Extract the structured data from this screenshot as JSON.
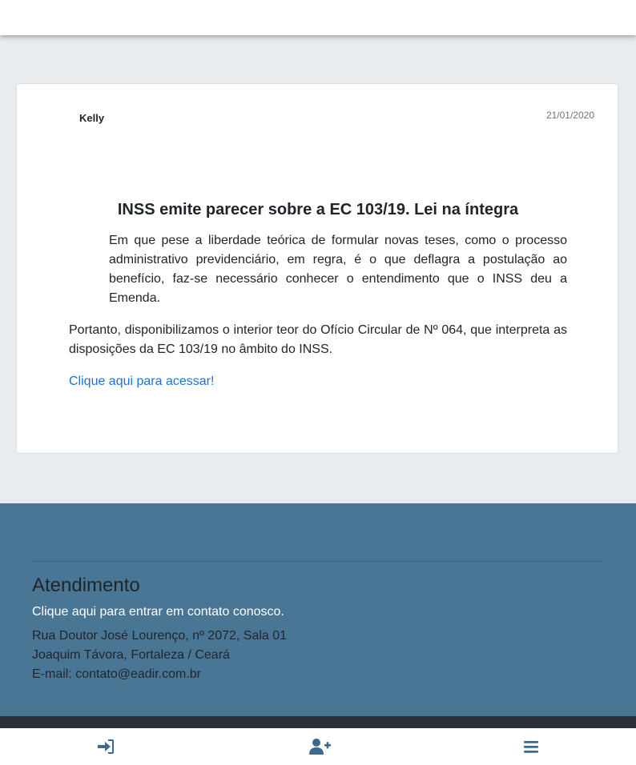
{
  "post": {
    "author": "Kelly",
    "date": "21/01/2020",
    "title": "INSS emite parecer sobre a EC 103/19. Lei na íntegra",
    "paragraphs": [
      "Em que pese a liberdade teórica de formular novas teses, como o processo administrativo previdenciário, em regra, é o que deflagra a postulação ao benefício, faz-se necessário conhecer o entendimento que o INSS deu a Emenda.",
      "Portanto, disponibilizamos o interior teor do Ofício Circular de Nº 064, que interpreta as disposições da EC 103/19 no âmbito do INSS."
    ],
    "link_label": "Clique aqui para acessar!"
  },
  "footer": {
    "title": "Atendimento",
    "contact_link": "Clique aqui para entrar em contato conosco.",
    "address_line1": "Rua Doutor José Lourenço, nº 2072, Sala 01",
    "address_line2": "Joaquim Távora, Fortaleza / Ceará",
    "email_line": "E-mail: contato@eadir.com.br"
  },
  "bottom_nav": {
    "items": [
      {
        "icon": "sign-in-icon"
      },
      {
        "icon": "user-plus-icon"
      },
      {
        "icon": "menu-icon"
      }
    ]
  },
  "colors": {
    "accent": "#1a73d9",
    "footer_bg": "#4a7696",
    "nav_icon": "#3d6a8c",
    "page_bg": "#e9ecef"
  }
}
